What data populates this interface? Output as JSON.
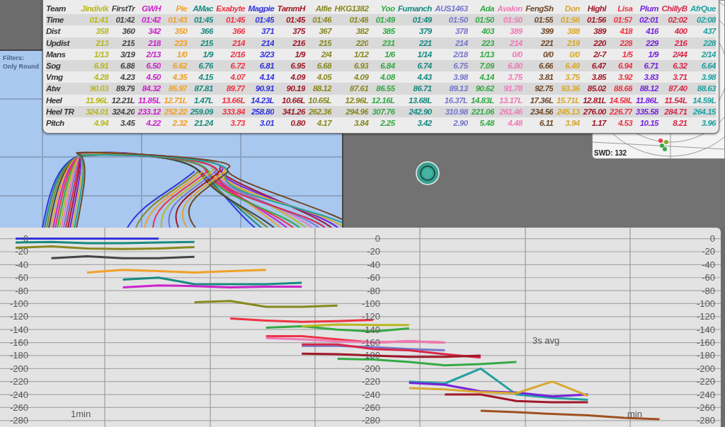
{
  "table": {
    "header": "Team",
    "teams": [
      {
        "name": "Jindivik",
        "color": "#b8b81e"
      },
      {
        "name": "FirstTr",
        "color": "#444444"
      },
      {
        "name": "GWH",
        "color": "#cc22cc"
      },
      {
        "name": "Pie",
        "color": "#f0a028"
      },
      {
        "name": "AMac",
        "color": "#178a80"
      },
      {
        "name": "Exabyte",
        "color": "#ee3344"
      },
      {
        "name": "Magpie",
        "color": "#3333dd"
      },
      {
        "name": "TammH",
        "color": "#a01828"
      },
      {
        "name": "Alfie",
        "color": "#888820"
      },
      {
        "name": "HKG1382",
        "color": "#888820"
      },
      {
        "name": "Yoo",
        "color": "#33aa44"
      },
      {
        "name": "Fumanch",
        "color": "#178a80"
      },
      {
        "name": "AUS1463",
        "color": "#7777cc"
      },
      {
        "name": "Ada",
        "color": "#33aa44"
      },
      {
        "name": "Avalon",
        "color": "#f07ab8"
      },
      {
        "name": "FengSh",
        "color": "#704828"
      },
      {
        "name": "Don",
        "color": "#d8a830"
      },
      {
        "name": "Highl",
        "color": "#a01828"
      },
      {
        "name": "Lisa",
        "color": "#ee3344"
      },
      {
        "name": "Plum",
        "color": "#7722dd"
      },
      {
        "name": "ChillyB",
        "color": "#d82848"
      },
      {
        "name": "AfrQue",
        "color": "#22a0a0"
      }
    ],
    "rows": [
      {
        "label": "Time",
        "values": [
          "01:41",
          "01:42",
          "01:42",
          "01:43",
          "01:45",
          "01:45",
          "01:45",
          "01:45",
          "01:46",
          "01:48",
          "01:49",
          "01:49",
          "01:50",
          "01:50",
          "01:50",
          "01:55",
          "01:56",
          "01:56",
          "01:57",
          "02:01",
          "02:02",
          "02:08"
        ]
      },
      {
        "label": "Dist",
        "values": [
          "358",
          "360",
          "342",
          "350",
          "366",
          "366",
          "371",
          "375",
          "367",
          "382",
          "385",
          "379",
          "378",
          "403",
          "389",
          "399",
          "388",
          "389",
          "418",
          "416",
          "400",
          "437"
        ]
      },
      {
        "label": "Updist",
        "values": [
          "213",
          "215",
          "218",
          "223",
          "215",
          "214",
          "214",
          "216",
          "215",
          "220",
          "231",
          "221",
          "214",
          "223",
          "214",
          "221",
          "219",
          "220",
          "228",
          "229",
          "216",
          "228"
        ]
      },
      {
        "label": "Mans",
        "values": [
          "1/13",
          "3/19",
          "2/13",
          "1/0",
          "1/9",
          "2/16",
          "3/23",
          "1/9",
          "2/4",
          "1/12",
          "1/6",
          "1/14",
          "2/18",
          "1/13",
          "0/0",
          "0/0",
          "0/0",
          "2/-7",
          "1/5",
          "1/9",
          "2/44",
          "2/14"
        ]
      },
      {
        "label": "Sog",
        "values": [
          "6.91",
          "6.88",
          "6.50",
          "6.62",
          "6.76",
          "6.72",
          "6.81",
          "6.95",
          "6.68",
          "6.93",
          "6.84",
          "6.74",
          "6.75",
          "7.09",
          "6.80",
          "6.66",
          "6.49",
          "6.47",
          "6.94",
          "6.71",
          "6.32",
          "6.64"
        ]
      },
      {
        "label": "Vmg",
        "values": [
          "4.28",
          "4.23",
          "4.50",
          "4.35",
          "4.15",
          "4.07",
          "4.14",
          "4.09",
          "4.05",
          "4.09",
          "4.08",
          "4.43",
          "3.98",
          "4.14",
          "3.75",
          "3.81",
          "3.75",
          "3.85",
          "3.92",
          "3.83",
          "3.71",
          "3.98"
        ]
      },
      {
        "label": "Atw",
        "values": [
          "90.03",
          "89.79",
          "84.32",
          "85.97",
          "87.81",
          "89.77",
          "90.91",
          "90.19",
          "88.12",
          "87.61",
          "86.55",
          "86.71",
          "89.13",
          "90.62",
          "91.78",
          "92.75",
          "93.36",
          "85.02",
          "88.68",
          "88.12",
          "87.40",
          "88.63"
        ]
      },
      {
        "label": "Heel",
        "values": [
          "11.96L",
          "12.21L",
          "11.85L",
          "12.71L",
          "1.47L",
          "13.66L",
          "14.23L",
          "10.66L",
          "10.65L",
          "12.96L",
          "12.16L",
          "13.68L",
          "16.37L",
          "14.83L",
          "13.17L",
          "17.36L",
          "15.71L",
          "12.81L",
          "14.58L",
          "11.86L",
          "11.54L",
          "14.59L"
        ]
      },
      {
        "label": "Heel TR",
        "values": [
          "324.01",
          "324.20",
          "233.12",
          "252.22",
          "259.09",
          "333.84",
          "258.80",
          "341.26",
          "262.36",
          "294.96",
          "307.76",
          "242.90",
          "310.98",
          "221.06",
          "261.46",
          "234.56",
          "245.13",
          "276.00",
          "226.77",
          "335.58",
          "284.71",
          "264.15"
        ]
      },
      {
        "label": "Pitch",
        "values": [
          "4.94",
          "3.45",
          "4.22",
          "2.32",
          "21.24",
          "3.73",
          "3.01",
          "0.80",
          "4.17",
          "3.84",
          "2.25",
          "3.42",
          "2.90",
          "5.48",
          "4.48",
          "6.11",
          "3.94",
          "1.17",
          "4.53",
          "10.15",
          "8.21",
          "3.96"
        ]
      }
    ]
  },
  "filters": {
    "title": "Filters:",
    "value": "Only Round"
  },
  "polar": {
    "label": "SWD: 132"
  },
  "chart": {
    "labels": [
      {
        "text": "1min"
      },
      {
        "text": "3s avg"
      },
      {
        "text": "min"
      }
    ],
    "extra_axes": [
      {
        "labels": [
          "0",
          "-20",
          "-40",
          "-60",
          "-80",
          "-100",
          "-120",
          "-140",
          "-160",
          "-180",
          "-200",
          "-220",
          "-240",
          "-260",
          "-280"
        ]
      },
      {
        "labels": [
          "0",
          "-20",
          "-40",
          "-60",
          "-80",
          "-100",
          "-120",
          "-140",
          "-160",
          "-180",
          "-200",
          "-220",
          "-240",
          "-260",
          "-280"
        ]
      }
    ],
    "chart_data": {
      "type": "line",
      "grid": true,
      "ylim": [
        -290,
        17
      ],
      "yticks": [
        0,
        -20,
        -40,
        -60,
        -80,
        -100,
        -120,
        -140,
        -160,
        -180,
        -200,
        -220,
        -240,
        -260,
        -280
      ],
      "series": [
        {
          "color": "#3333dd",
          "values": [
            0,
            0,
            0,
            0,
            0,
            null,
            null,
            null,
            null,
            null,
            null,
            null,
            null,
            null,
            null,
            null,
            null,
            null,
            null,
            null
          ]
        },
        {
          "color": "#178a80",
          "values": [
            -6,
            -5,
            -7,
            -7,
            -6,
            -5,
            null,
            null,
            null,
            null,
            null,
            null,
            null,
            null,
            null,
            null,
            null,
            null,
            null,
            null
          ]
        },
        {
          "color": "#888820",
          "values": [
            -14,
            -12,
            -15,
            -16,
            -15,
            -13,
            null,
            null,
            null,
            null,
            null,
            null,
            null,
            null,
            null,
            null,
            null,
            null,
            null,
            null
          ]
        },
        {
          "color": "#444444",
          "values": [
            null,
            -30,
            -27,
            -30,
            -30,
            -28,
            null,
            null,
            null,
            null,
            null,
            null,
            null,
            null,
            null,
            null,
            null,
            null,
            null,
            null
          ]
        },
        {
          "color": "#f0a028",
          "values": [
            null,
            null,
            -52,
            -48,
            -50,
            -52,
            -50,
            -48,
            null,
            null,
            null,
            null,
            null,
            null,
            null,
            null,
            null,
            null,
            null,
            null
          ]
        },
        {
          "color": "#178a80",
          "values": [
            null,
            null,
            null,
            -63,
            -60,
            -70,
            -70,
            -70,
            -68,
            null,
            null,
            null,
            null,
            null,
            null,
            null,
            null,
            null,
            null,
            null
          ]
        },
        {
          "color": "#cc22cc",
          "values": [
            null,
            null,
            null,
            -75,
            -72,
            -73,
            -75,
            -74,
            -74,
            null,
            null,
            null,
            null,
            null,
            null,
            null,
            null,
            null,
            null,
            null
          ]
        },
        {
          "color": "#888820",
          "values": [
            null,
            null,
            null,
            null,
            null,
            -98,
            -96,
            -105,
            -105,
            -103,
            null,
            null,
            null,
            null,
            null,
            null,
            null,
            null,
            null,
            null
          ]
        },
        {
          "color": "#ee3344",
          "values": [
            null,
            null,
            null,
            null,
            null,
            null,
            -123,
            -126,
            -128,
            -127,
            -125,
            null,
            null,
            null,
            null,
            null,
            null,
            null,
            null,
            null
          ]
        },
        {
          "color": "#33aa44",
          "values": [
            null,
            null,
            null,
            null,
            null,
            null,
            null,
            -137,
            -135,
            -140,
            -143,
            -138,
            null,
            null,
            null,
            null,
            null,
            null,
            null,
            null
          ]
        },
        {
          "color": "#b8b81e",
          "values": [
            null,
            null,
            null,
            null,
            null,
            null,
            null,
            null,
            -135,
            -132,
            -133,
            -133,
            null,
            null,
            null,
            null,
            null,
            null,
            null,
            null
          ]
        },
        {
          "color": "#ee3344",
          "values": [
            null,
            null,
            null,
            null,
            null,
            null,
            null,
            -150,
            -150,
            -155,
            -160,
            -158,
            -160,
            null,
            null,
            null,
            null,
            null,
            null,
            null
          ]
        },
        {
          "color": "#f07ab8",
          "values": [
            null,
            null,
            null,
            null,
            null,
            null,
            null,
            -153,
            -155,
            -158,
            -160,
            -158,
            -160,
            null,
            null,
            null,
            null,
            null,
            null,
            null
          ]
        },
        {
          "color": "#7777cc",
          "values": [
            null,
            null,
            null,
            null,
            null,
            null,
            null,
            null,
            -165,
            -165,
            -167,
            -170,
            -172,
            null,
            null,
            null,
            null,
            null,
            null,
            null
          ]
        },
        {
          "color": "#d82848",
          "values": [
            null,
            null,
            null,
            null,
            null,
            null,
            null,
            null,
            -163,
            -163,
            -170,
            -172,
            -178,
            -183,
            null,
            null,
            null,
            null,
            null,
            null
          ]
        },
        {
          "color": "#a01828",
          "values": [
            null,
            null,
            null,
            null,
            null,
            null,
            null,
            null,
            -177,
            -178,
            -180,
            -182,
            -182,
            -180,
            null,
            null,
            null,
            null,
            null,
            null
          ]
        },
        {
          "color": "#33aa44",
          "values": [
            null,
            null,
            null,
            null,
            null,
            null,
            null,
            null,
            null,
            -185,
            -186,
            -190,
            -195,
            -193,
            -190,
            null,
            null,
            null,
            null,
            null
          ]
        },
        {
          "color": "#22a0a0",
          "values": [
            null,
            null,
            null,
            null,
            null,
            null,
            null,
            null,
            null,
            null,
            null,
            -220,
            -223,
            -200,
            -240,
            -245,
            -248,
            null,
            null,
            null
          ]
        },
        {
          "color": "#7722dd",
          "values": [
            null,
            null,
            null,
            null,
            null,
            null,
            null,
            null,
            null,
            null,
            null,
            -222,
            -225,
            -235,
            -237,
            -243,
            -240,
            null,
            null,
            null
          ]
        },
        {
          "color": "#d8a830",
          "values": [
            null,
            null,
            null,
            null,
            null,
            null,
            null,
            null,
            null,
            null,
            null,
            -230,
            -232,
            -236,
            -238,
            -220,
            -242,
            null,
            null,
            null
          ]
        },
        {
          "color": "#a01828",
          "values": [
            null,
            null,
            null,
            null,
            null,
            null,
            null,
            null,
            null,
            null,
            null,
            null,
            -240,
            -240,
            -250,
            -252,
            -252,
            null,
            null,
            null
          ]
        },
        {
          "color": "#a05020",
          "values": [
            null,
            null,
            null,
            null,
            null,
            null,
            null,
            null,
            null,
            null,
            null,
            null,
            null,
            -265,
            -267,
            -270,
            -272,
            -276,
            -278,
            null
          ]
        }
      ]
    }
  }
}
